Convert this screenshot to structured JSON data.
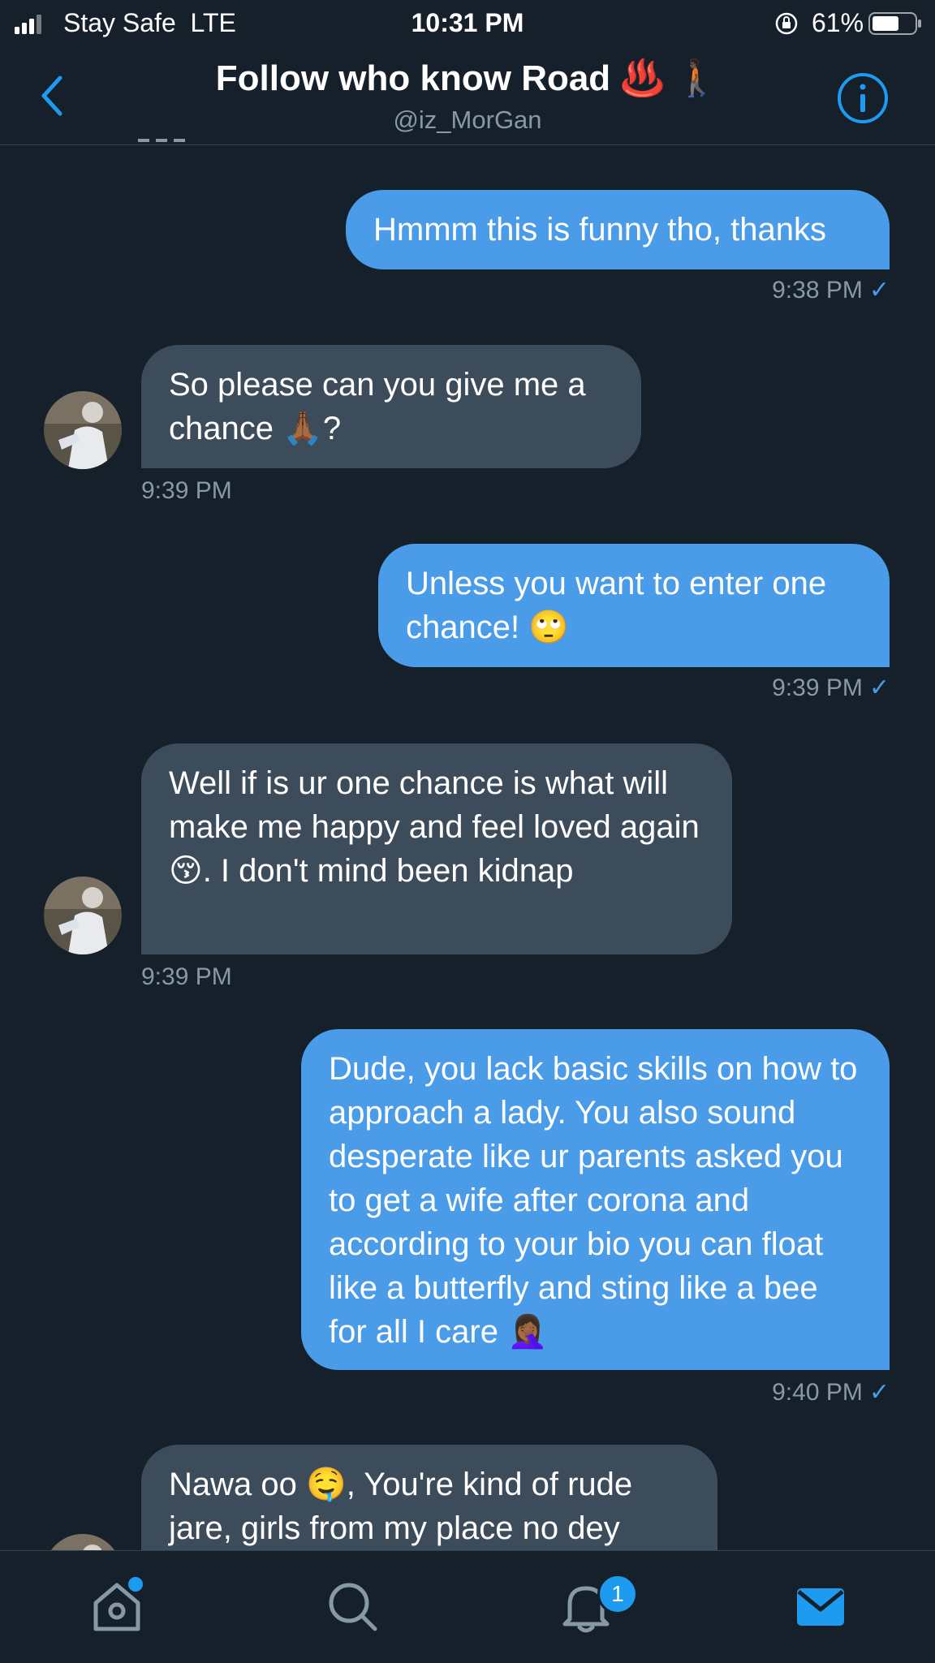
{
  "status_bar": {
    "carrier": "Stay Safe",
    "network": "LTE",
    "time": "10:31 PM",
    "battery": "61%"
  },
  "header": {
    "title": "Follow who know Road ♨️ 🚶🏿",
    "handle": "@iz_MorGan"
  },
  "messages": [
    {
      "side": "sent",
      "text": "Hmmm this is funny tho, thanks",
      "time": "9:38 PM",
      "check": "✓"
    },
    {
      "side": "received",
      "text": "So please can you give me a chance 🙏🏾?",
      "time": "9:39 PM"
    },
    {
      "side": "sent",
      "text": "Unless you want to enter one chance! 🙄",
      "time": "9:39 PM",
      "check": "✓"
    },
    {
      "side": "received",
      "text": "Well if is ur one chance is what will make me happy and feel loved again 😚. I don't mind been kidnap",
      "time": "9:39 PM"
    },
    {
      "side": "sent",
      "text": "Dude, you lack basic skills on how to approach a lady. You also sound desperate like ur parents asked you to get a wife after corona and according to your bio you can float like a butterfly and sting like a bee for all I care 🤦🏾‍♀️",
      "time": "9:40 PM",
      "check": "✓"
    },
    {
      "side": "received",
      "text": "Nawa oo 🤤, You're kind of rude jare, girls from my place no dey"
    }
  ],
  "tabbar": {
    "notifications_badge": "1"
  },
  "icons": {
    "back": "chevron-left-icon",
    "info": "info-icon",
    "home": "home-icon",
    "search": "search-icon",
    "notifications": "bell-icon",
    "messages": "mail-icon"
  },
  "colors": {
    "background": "#15202b",
    "sent_bubble": "#4a9be8",
    "received_bubble": "#3d4c5a",
    "accent": "#1d9bf0",
    "muted": "#8899a6"
  }
}
